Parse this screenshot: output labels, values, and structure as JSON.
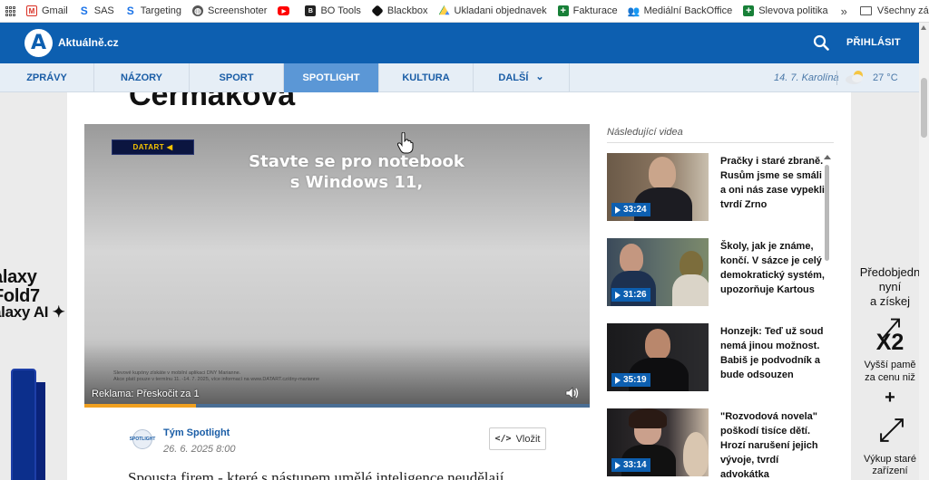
{
  "bookmarks": {
    "items": [
      {
        "label": "Gmail",
        "icon": "gmail-icon",
        "color": "#d93025"
      },
      {
        "label": "SAS",
        "icon": "s-icon",
        "color": "#1a73e8"
      },
      {
        "label": "Targeting",
        "icon": "s-icon",
        "color": "#1a73e8"
      },
      {
        "label": "Screenshoter",
        "icon": "globe-icon",
        "color": "#555555"
      },
      {
        "label": "",
        "icon": "youtube-icon",
        "color": "#ff0000"
      },
      {
        "label": "BO Tools",
        "icon": "bo-icon",
        "color": "#222222"
      },
      {
        "label": "Blackbox",
        "icon": "cube-icon",
        "color": "#111111"
      },
      {
        "label": "Ukladani objednavek",
        "icon": "drive-icon",
        "color": "#1fa463"
      },
      {
        "label": "Fakturace",
        "icon": "sheets-plus-icon",
        "color": "#188038"
      },
      {
        "label": "Mediální BackOffice",
        "icon": "people-icon",
        "color": "#4a6fb3"
      },
      {
        "label": "Slevova politika",
        "icon": "sheets-plus-icon",
        "color": "#188038"
      }
    ],
    "more": "»",
    "folder": "Všechny záložky"
  },
  "header": {
    "logo_letter": "A",
    "logo_text": "Aktuálně.cz",
    "login": "PŘIHLÁSIT",
    "brand_color": "#0d5fb0"
  },
  "nav": {
    "tabs": [
      {
        "label": "ZPRÁVY",
        "active": false
      },
      {
        "label": "NÁZORY",
        "active": false
      },
      {
        "label": "SPORT",
        "active": false
      },
      {
        "label": "SPOTLIGHT",
        "active": true
      },
      {
        "label": "KULTURA",
        "active": false
      },
      {
        "label": "DALŠÍ",
        "active": false
      }
    ],
    "more_chevron": "⌄",
    "date_name": "14. 7. Karolína",
    "temperature": "27 °C"
  },
  "article": {
    "title_fragment": "Čermáková",
    "author": "Tým Spotlight",
    "author_avatar_text": "SPOTLIGHT",
    "date": "26. 6. 2025 8:00",
    "embed_label": "Vložit",
    "lead": "Spousta firem - které s nástupem umělé inteligence neudělají"
  },
  "video": {
    "brand": "DATART ◀",
    "ad_line1": "Stavte se pro notebook",
    "ad_line2": "s Windows 11,",
    "small_print1": "Slevové kupóny získáte v mobilní aplikaci DNY Marianne.",
    "small_print2": "Akce platí pouze v termínu 11. -14. 7. 2025, více informací na www.DATART.cz/dny-marianne",
    "skip_label": "Reklama: Přeskočit za 1",
    "progress": 0.22
  },
  "sidebar": {
    "heading": "Následující videa",
    "videos": [
      {
        "title": "Pračky i staré zbraně. Rusům jsme se smáli a oni nás zase vypekli, tvrdí Zrno",
        "duration": "33:24"
      },
      {
        "title": "Školy, jak je známe, končí. V sázce je celý demokratický systém, upozorňuje Kartous",
        "duration": "31:26"
      },
      {
        "title": "Honzejk: Teď už soud nemá jinou možnost. Babiš je podvodník a bude odsouzen",
        "duration": "35:19"
      },
      {
        "title": "\"Rozvodová novela\" poškodí tisíce dětí. Hrozí narušení jejich vývoje, tvrdí advokátka",
        "duration": "33:14"
      }
    ]
  },
  "ads": {
    "left": [
      "alaxy",
      "Fold7",
      "alaxy AI ✦"
    ],
    "right": {
      "line1": "Předobjedn",
      "line2": "nyní",
      "line3": "a získej",
      "big": "X2",
      "line4": "Vyšší pamě",
      "line5": "za cenu niž",
      "plus": "+",
      "line6": "Výkup staré",
      "line7": "zařízení"
    }
  }
}
